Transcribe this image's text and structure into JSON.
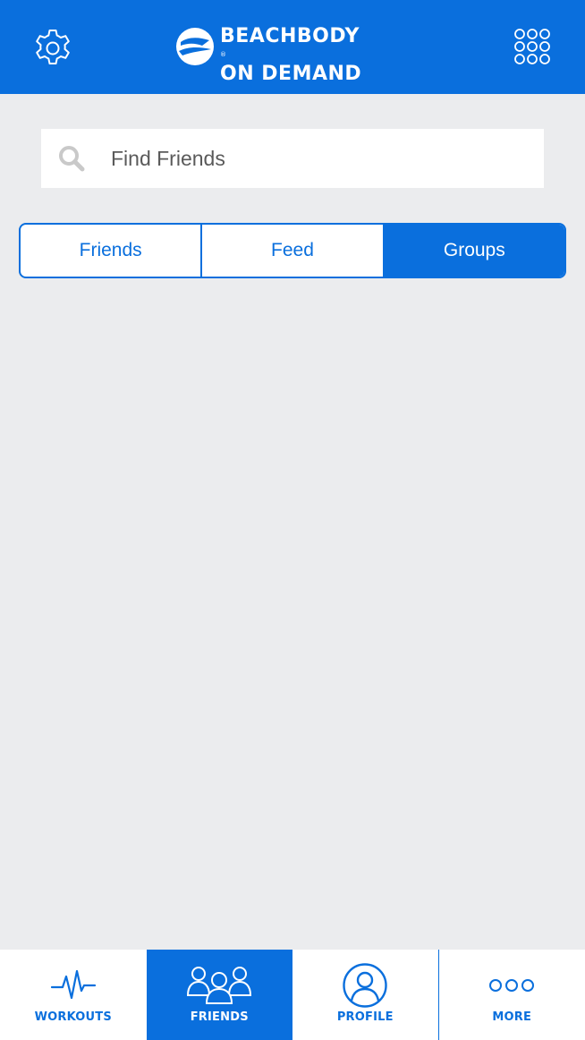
{
  "app": {
    "logo_line1": "BEACHBODY",
    "logo_line2": "ON DEMAND",
    "logo_reg": "®"
  },
  "header": {
    "left_icon": "gear-icon",
    "right_icon": "app-grid-icon"
  },
  "search": {
    "placeholder": "Find Friends",
    "value": "",
    "icon": "search-icon"
  },
  "tabs": [
    {
      "label": "Friends",
      "active": false
    },
    {
      "label": "Feed",
      "active": false
    },
    {
      "label": "Groups",
      "active": true
    }
  ],
  "bottom_nav": [
    {
      "label": "WORKOUTS",
      "icon": "pulse-icon",
      "active": false
    },
    {
      "label": "FRIENDS",
      "icon": "people-icon",
      "active": true
    },
    {
      "label": "PROFILE",
      "icon": "person-icon",
      "active": false
    },
    {
      "label": "MORE",
      "icon": "more-dots-icon",
      "active": false
    }
  ],
  "colors": {
    "brand_blue": "#0a6fdd",
    "background": "#ebecee",
    "white": "#ffffff"
  }
}
